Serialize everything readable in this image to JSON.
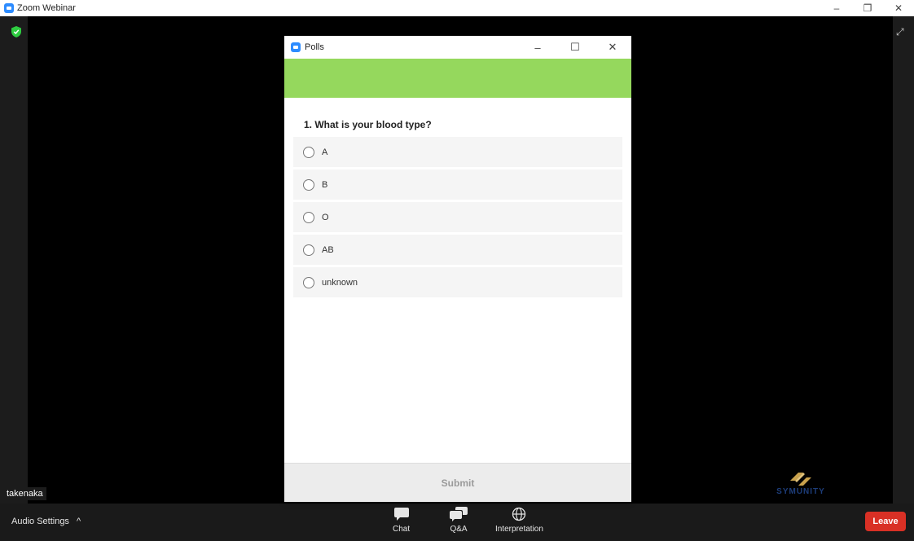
{
  "window": {
    "title": "Zoom Webinar",
    "controls": [
      "–",
      "❐",
      "✕"
    ]
  },
  "stage": {
    "participant_name": "takenaka",
    "logo_text": "SYMUNITY"
  },
  "toolbar": {
    "audio_settings": "Audio Settings",
    "audio_caret": "^",
    "buttons": [
      {
        "label": "Chat",
        "icon": "chat-icon"
      },
      {
        "label": "Q&A",
        "icon": "qa-icon"
      },
      {
        "label": "Interpretation",
        "icon": "globe-icon"
      }
    ],
    "leave": "Leave",
    "leave_color": "#d93025"
  },
  "poll": {
    "title": "Polls",
    "controls": [
      "–",
      "☐",
      "✕"
    ],
    "banner_color": "#95d85d",
    "question": "1. What is your blood type?",
    "options": [
      "A",
      "B",
      "O",
      "AB",
      "unknown"
    ],
    "submit": "Submit"
  }
}
